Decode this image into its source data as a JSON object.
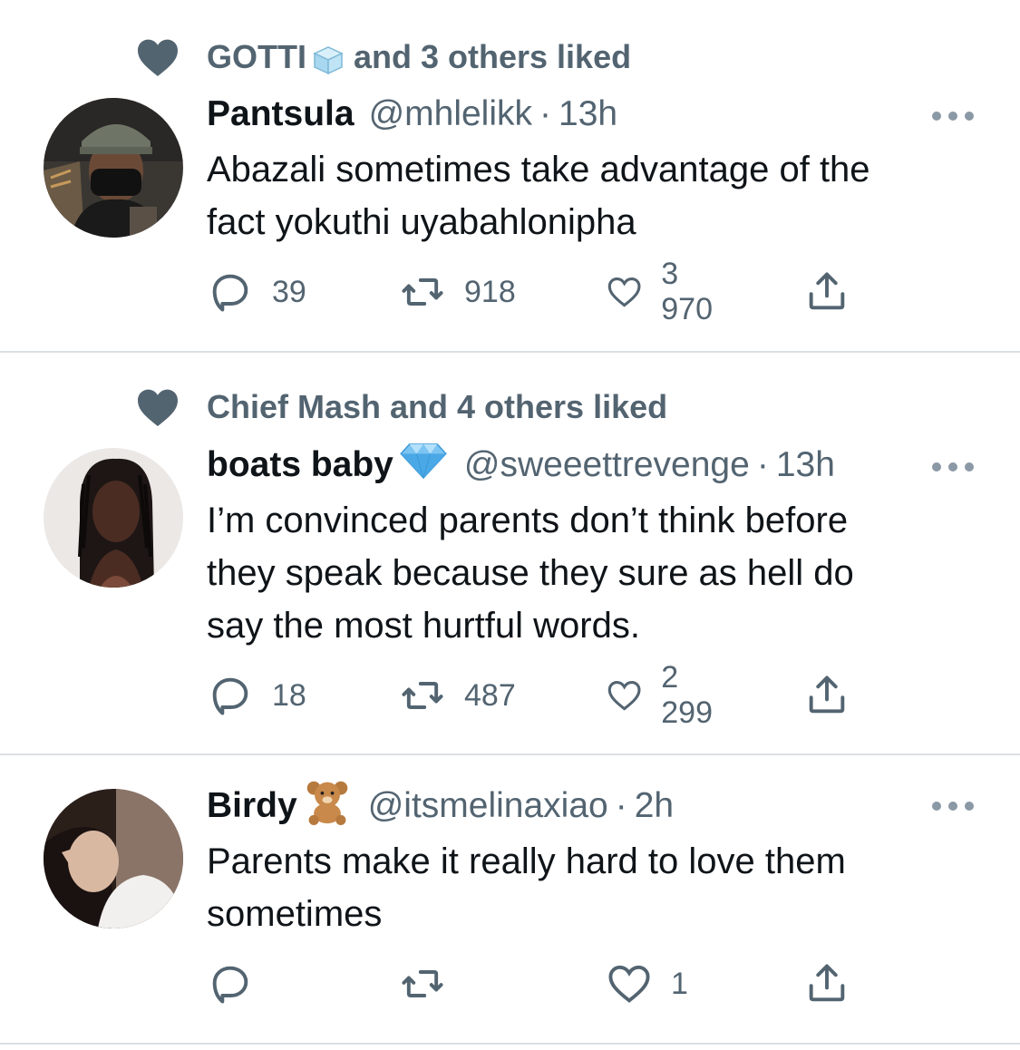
{
  "tweets": [
    {
      "social": {
        "user": "GOTTI",
        "text": "and 3 others liked",
        "icon": "ice-cube-emoji"
      },
      "name": "Pantsula",
      "handle": "@mhlelikk",
      "dot": "·",
      "time": "13h",
      "lines": [
        "Abazali sometimes take advantage of the",
        "fact yokuthi uyabahlonipha"
      ],
      "replies": "39",
      "retweets": "918",
      "likes": "3 970"
    },
    {
      "social": {
        "user": "Chief Mash",
        "text": "and 4 others liked"
      },
      "name": "boats baby",
      "name_emoji": "gem-emoji",
      "handle": "@sweeettrevenge",
      "dot": "·",
      "time": "13h",
      "lines": [
        "I’m convinced parents don’t think before",
        "they speak because they sure as hell do",
        "say the most hurtful words."
      ],
      "replies": "18",
      "retweets": "487",
      "likes": "2 299"
    },
    {
      "name": "Birdy",
      "name_emoji": "teddy-bear-emoji",
      "handle": "@itsmelinaxiao",
      "dot": "·",
      "time": "2h",
      "lines": [
        "Parents make it really hard to love them",
        "sometimes"
      ],
      "replies": "",
      "retweets": "",
      "likes": "1"
    }
  ],
  "colors": {
    "text": "#0f1419",
    "secondary": "#536471",
    "divider": "#dcdfe3",
    "background": "#ffffff"
  }
}
